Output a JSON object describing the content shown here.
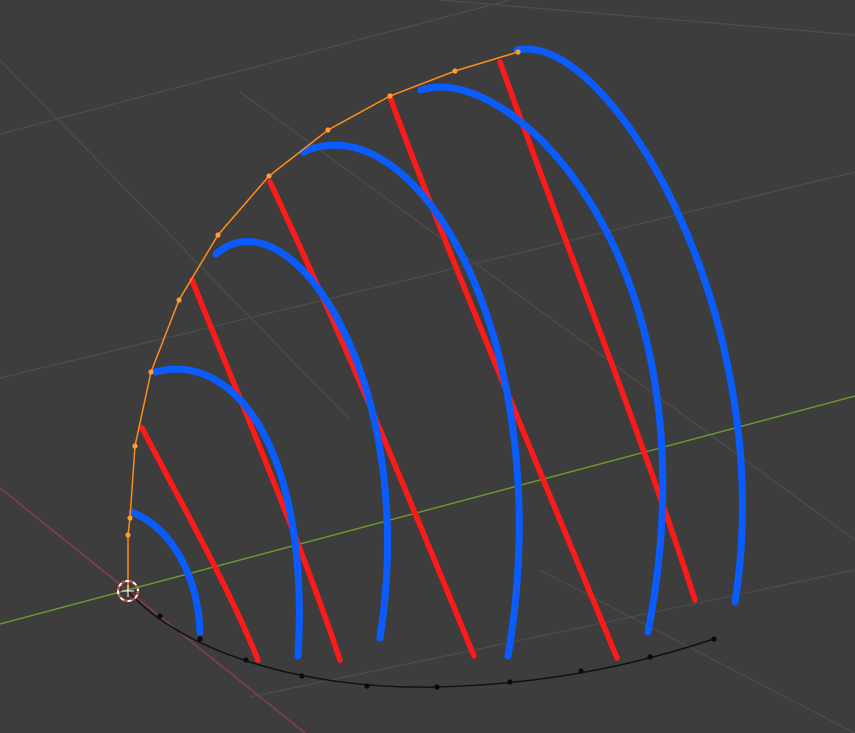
{
  "viewport": {
    "background": "#3d3d3d"
  },
  "colors": {
    "grid": "#4d4d4d",
    "x_axis": "#8a3f4a",
    "y_axis": "#6e9a2c",
    "selected_curve": "#ff8c1a",
    "selected_point": "#ff9d2e",
    "unselected_curve": "#111111",
    "unselected_point": "#0a0a0a",
    "red_strands": "#ff1a1a",
    "blue_strands": "#0a5cff",
    "cursor_red": "#e0413a",
    "cursor_white": "#ffffff"
  },
  "icons": {
    "cursor": "3d-cursor-icon"
  }
}
